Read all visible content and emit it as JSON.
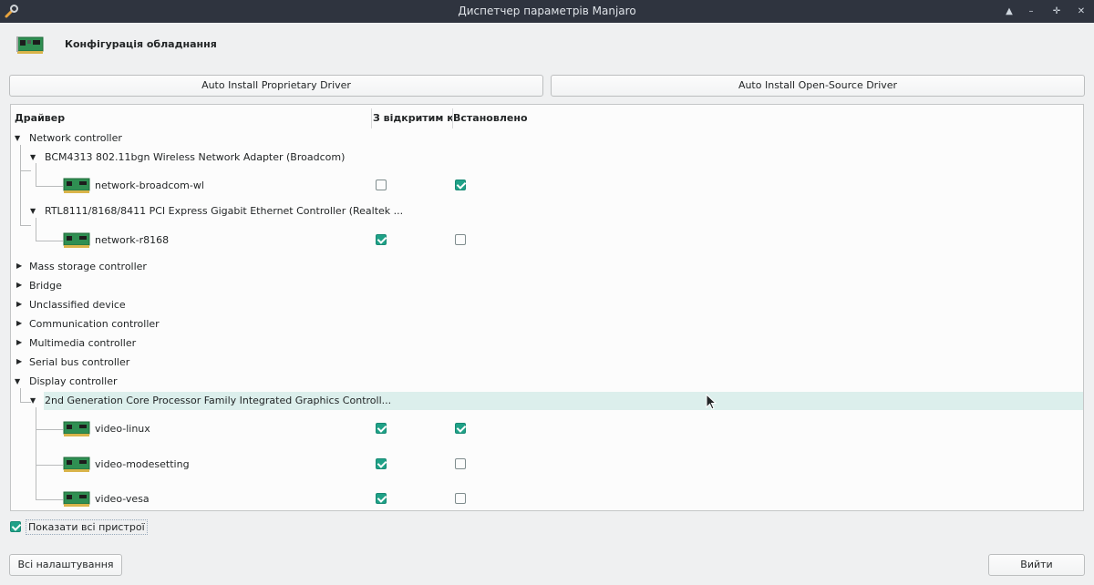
{
  "window": {
    "title": "Диспетчер параметрів Manjaro",
    "controls": [
      "▲",
      "–",
      "✛",
      "✕"
    ]
  },
  "header": {
    "title": "Конфігурація обладнання",
    "icon": "pci-card-icon"
  },
  "toolbar": {
    "proprietary_label": "Auto Install Proprietary Driver",
    "open_source_label": "Auto Install Open-Source Driver"
  },
  "tree": {
    "columns": {
      "driver": "Драйвер",
      "open_source": "З відкритим кодом",
      "installed": "Встановлено"
    },
    "rows": [
      {
        "label": "Network controller",
        "level": 0,
        "expanded": true
      },
      {
        "label": "BCM4313 802.11bgn Wireless Network Adapter (Broadcom)",
        "level": 1,
        "expanded": true
      },
      {
        "label": "network-broadcom-wl",
        "level": 2,
        "open_source": false,
        "installed": true
      },
      {
        "label": "RTL8111/8168/8411 PCI Express Gigabit Ethernet Controller (Realtek ...",
        "level": 1,
        "expanded": true
      },
      {
        "label": "network-r8168",
        "level": 2,
        "open_source": true,
        "installed": false
      },
      {
        "label": "Mass storage controller",
        "level": 0,
        "expanded": false
      },
      {
        "label": "Bridge",
        "level": 0,
        "expanded": false
      },
      {
        "label": "Unclassified device",
        "level": 0,
        "expanded": false
      },
      {
        "label": "Communication controller",
        "level": 0,
        "expanded": false
      },
      {
        "label": "Multimedia controller",
        "level": 0,
        "expanded": false
      },
      {
        "label": "Serial bus controller",
        "level": 0,
        "expanded": false
      },
      {
        "label": "Display controller",
        "level": 0,
        "expanded": true
      },
      {
        "label": "2nd Generation Core Processor Family Integrated Graphics Controll...",
        "level": 1,
        "expanded": true,
        "selected": true
      },
      {
        "label": "video-linux",
        "level": 2,
        "open_source": true,
        "installed": true
      },
      {
        "label": "video-modesetting",
        "level": 2,
        "open_source": true,
        "installed": false
      },
      {
        "label": "video-vesa",
        "level": 2,
        "open_source": true,
        "installed": false
      }
    ]
  },
  "footer": {
    "show_all_label": "Показати всі пристрої",
    "show_all_checked": true,
    "settings_label": "Всі налаштування",
    "exit_label": "Вийти"
  },
  "colors": {
    "titlebar": "#2f343f",
    "accent_check": "#1fa187",
    "selected_row": "#dcefec"
  }
}
